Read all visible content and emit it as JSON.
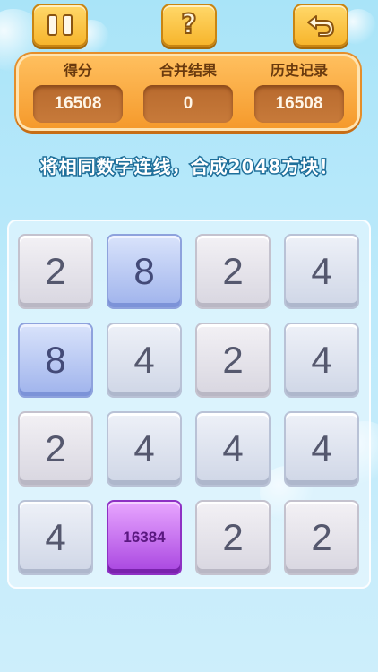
{
  "controls": {
    "pause_icon": "pause-icon",
    "help_label": "?",
    "undo_icon": "undo-arrow-icon"
  },
  "score_panel": {
    "score_label": "得分",
    "score_value": "16508",
    "merge_label": "合并结果",
    "merge_value": "0",
    "best_label": "历史记录",
    "best_value": "16508",
    "panel_color": "#f7a53a"
  },
  "instruction": "将相同数字连线，合成2048方块！",
  "board": {
    "tiles": [
      [
        "2",
        "8",
        "2",
        "4"
      ],
      [
        "8",
        "4",
        "2",
        "4"
      ],
      [
        "2",
        "4",
        "4",
        "4"
      ],
      [
        "4",
        "16384",
        "2",
        "2"
      ]
    ]
  },
  "colors": {
    "background": "#b8e8fa",
    "tile_2": "#e6e4ec",
    "tile_4": "#dde3ef",
    "tile_8": "#b7c6f2",
    "tile_16384": "#c46cf0"
  }
}
